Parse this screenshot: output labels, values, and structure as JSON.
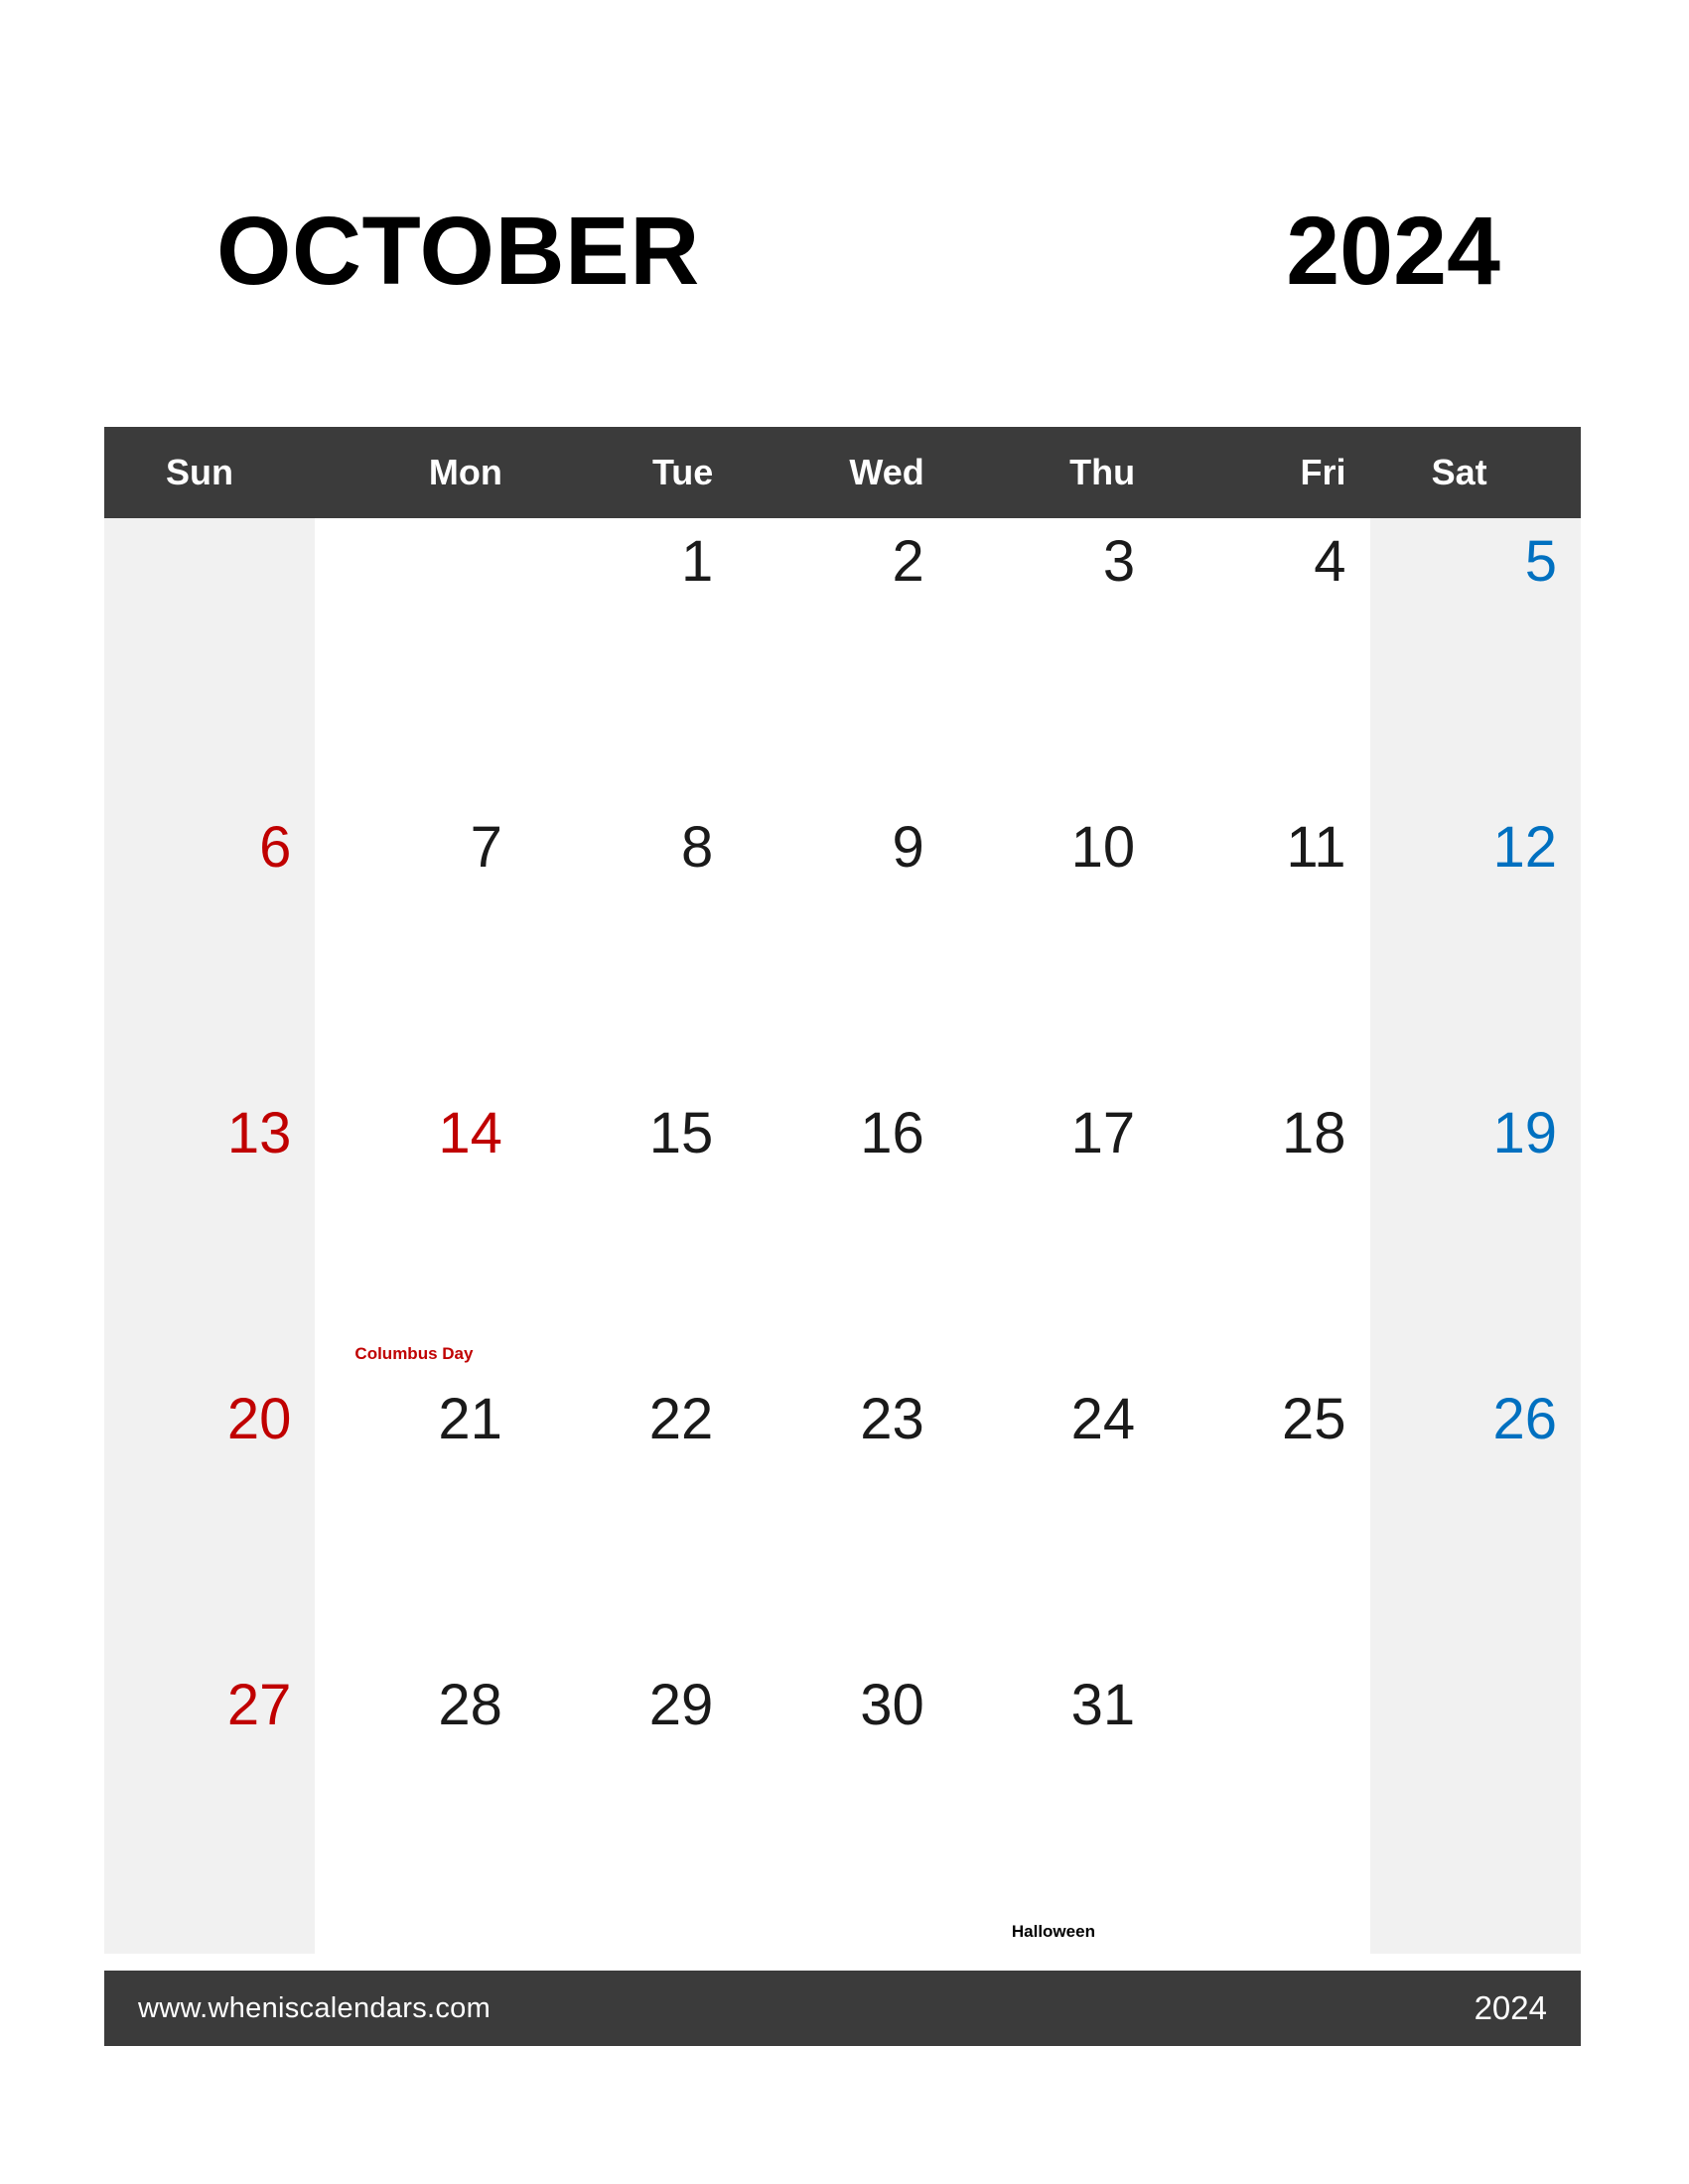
{
  "header": {
    "month": "OCTOBER",
    "year": "2024"
  },
  "weekdays": [
    {
      "short": "Sun"
    },
    {
      "short": "Mon"
    },
    {
      "short": "Tue"
    },
    {
      "short": "Wed"
    },
    {
      "short": "Thu"
    },
    {
      "short": "Fri"
    },
    {
      "short": "Sat"
    }
  ],
  "colors": {
    "header_bar": "#3b3b3b",
    "weekend_shade": "#f1f1f1",
    "sunday_text": "#c00000",
    "saturday_text": "#0070c0",
    "weekday_text": "#1a1a1a"
  },
  "weeks": [
    {
      "days": [
        {
          "num": "",
          "note": ""
        },
        {
          "num": "",
          "note": ""
        },
        {
          "num": "1",
          "note": ""
        },
        {
          "num": "2",
          "note": ""
        },
        {
          "num": "3",
          "note": ""
        },
        {
          "num": "4",
          "note": ""
        },
        {
          "num": "5",
          "note": ""
        }
      ]
    },
    {
      "days": [
        {
          "num": "6",
          "note": ""
        },
        {
          "num": "7",
          "note": ""
        },
        {
          "num": "8",
          "note": ""
        },
        {
          "num": "9",
          "note": ""
        },
        {
          "num": "10",
          "note": ""
        },
        {
          "num": "11",
          "note": ""
        },
        {
          "num": "12",
          "note": ""
        }
      ]
    },
    {
      "days": [
        {
          "num": "13",
          "note": ""
        },
        {
          "num": "14",
          "note": "Columbus Day"
        },
        {
          "num": "15",
          "note": ""
        },
        {
          "num": "16",
          "note": ""
        },
        {
          "num": "17",
          "note": ""
        },
        {
          "num": "18",
          "note": ""
        },
        {
          "num": "19",
          "note": ""
        }
      ]
    },
    {
      "days": [
        {
          "num": "20",
          "note": ""
        },
        {
          "num": "21",
          "note": ""
        },
        {
          "num": "22",
          "note": ""
        },
        {
          "num": "23",
          "note": ""
        },
        {
          "num": "24",
          "note": ""
        },
        {
          "num": "25",
          "note": ""
        },
        {
          "num": "26",
          "note": ""
        }
      ]
    },
    {
      "days": [
        {
          "num": "27",
          "note": ""
        },
        {
          "num": "28",
          "note": ""
        },
        {
          "num": "29",
          "note": ""
        },
        {
          "num": "30",
          "note": ""
        },
        {
          "num": "31",
          "note": "Halloween"
        },
        {
          "num": "",
          "note": ""
        },
        {
          "num": "",
          "note": ""
        }
      ]
    }
  ],
  "footer": {
    "url": "www.wheniscalendars.com",
    "year": "2024"
  }
}
